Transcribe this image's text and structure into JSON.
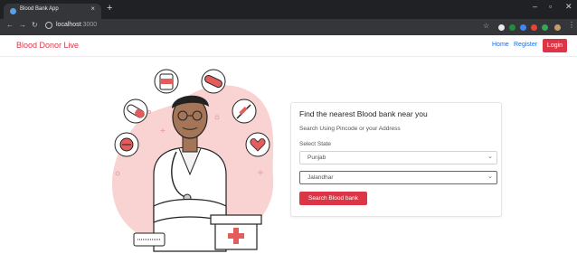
{
  "browser": {
    "tab_title": "Blood Bank App",
    "tab_close": "×",
    "new_tab": "+",
    "window_controls": {
      "minimize": "–",
      "maximize": "▫",
      "close": "✕"
    },
    "url_host": "localhost",
    "url_port": ":3000",
    "nav_icons": [
      "arrow-left-icon",
      "arrow-right-icon",
      "reload-icon"
    ],
    "extension_colors": [
      "#e8eaed",
      "#1e8e3e",
      "#4285f4",
      "#ea4335",
      "#34a853"
    ]
  },
  "navbar": {
    "brand": "Blood Donor Live",
    "links": [
      "Home",
      "Register"
    ],
    "login_label": "Login"
  },
  "search_card": {
    "title": "Find the nearest Blood bank near you",
    "subtitle": "Search Using Pincode or your Address",
    "state_label": "Select State",
    "state_value": "Punjab",
    "district_value": "Jalandhar",
    "button_label": "Search Blood bank"
  },
  "colors": {
    "accent": "#dc3545",
    "blob": "#f9d2d2",
    "doctor_shirt": "#ffffff",
    "doctor_skin": "#a57558"
  }
}
